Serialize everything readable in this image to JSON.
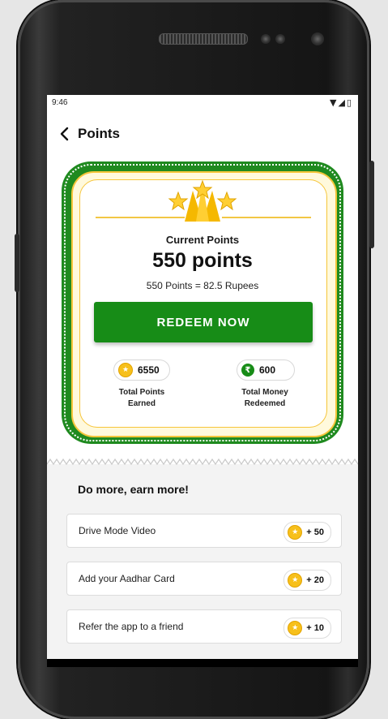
{
  "status_bar": {
    "time": "9:46",
    "icons": "▼◢▯"
  },
  "header": {
    "back_icon": "chevron-left-icon",
    "title": "Points"
  },
  "points_card": {
    "label": "Current Points",
    "points": "550 points",
    "conversion": "550 Points = 82.5 Rupees",
    "redeem_label": "REDEEM NOW",
    "stats": [
      {
        "icon": "star-coin-icon",
        "value": "6550",
        "label_line1": "Total Points",
        "label_line2": "Earned"
      },
      {
        "icon": "rupee-coin-icon",
        "value": "600",
        "label_line1": "Total Money",
        "label_line2": "Redeemed"
      }
    ]
  },
  "earn": {
    "title": "Do more, earn more!",
    "tasks": [
      {
        "label": "Drive Mode Video",
        "reward": "+ 50"
      },
      {
        "label": "Add your Aadhar Card",
        "reward": "+ 20"
      },
      {
        "label": "Refer the app to a friend",
        "reward": "+ 10"
      }
    ]
  },
  "colors": {
    "brand_green": "#178c17",
    "gold": "#f6c53a",
    "coin": "#f7c01b"
  }
}
